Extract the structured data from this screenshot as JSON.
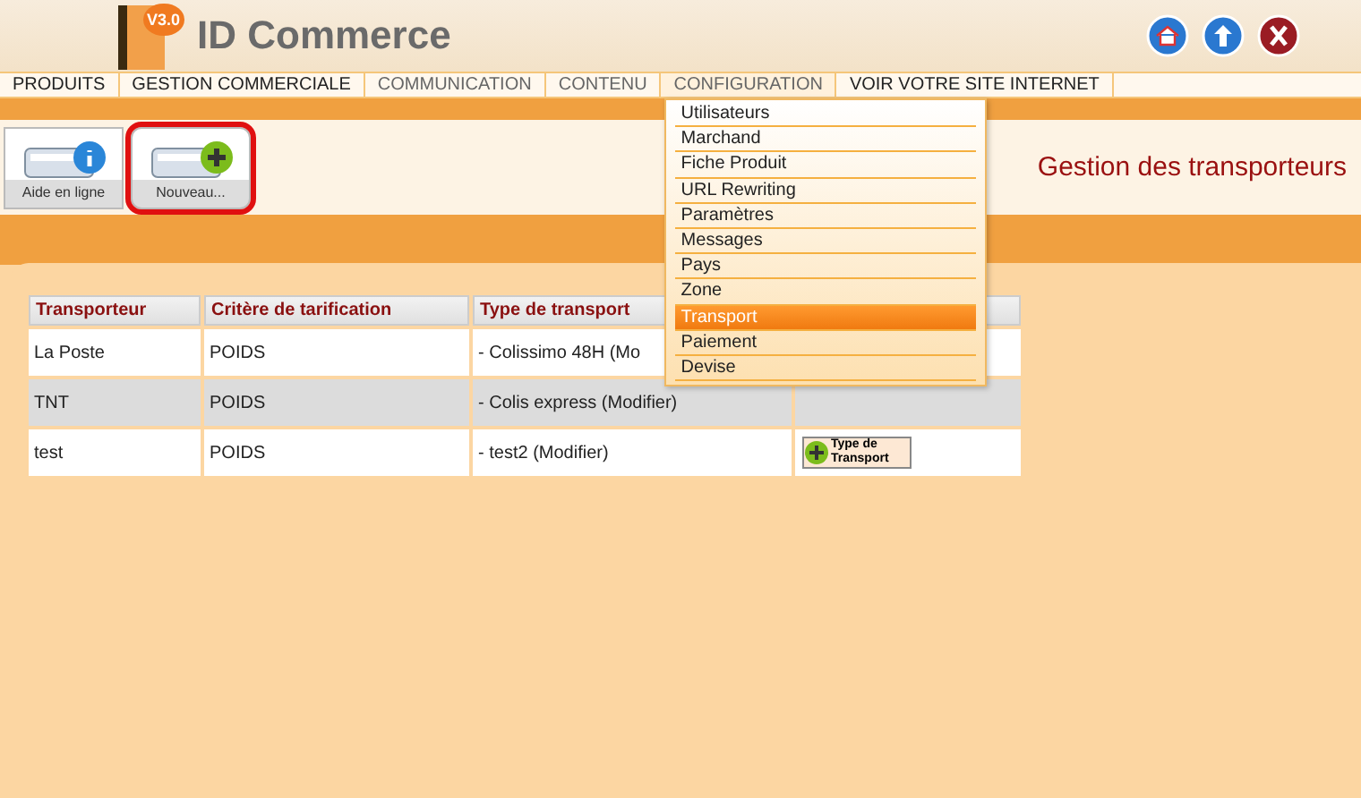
{
  "header": {
    "logo_badge": "V3.0",
    "brand": "ID Commerce"
  },
  "nav": [
    {
      "label": "PRODUITS",
      "selected": false,
      "dimmed": false
    },
    {
      "label": "GESTION COMMERCIALE",
      "selected": false,
      "dimmed": false
    },
    {
      "label": "COMMUNICATION",
      "selected": false,
      "dimmed": true
    },
    {
      "label": "CONTENU",
      "selected": false,
      "dimmed": true
    },
    {
      "label": "CONFIGURATION",
      "selected": true,
      "dimmed": true
    },
    {
      "label": "VOIR VOTRE SITE INTERNET",
      "selected": false,
      "dimmed": false
    }
  ],
  "dropdown": [
    {
      "label": "Utilisateurs",
      "selected": false
    },
    {
      "label": "Marchand",
      "selected": false
    },
    {
      "label": "Fiche Produit",
      "selected": false
    },
    {
      "label": "URL Rewriting",
      "selected": false
    },
    {
      "label": "Paramètres",
      "selected": false
    },
    {
      "label": "Messages",
      "selected": false
    },
    {
      "label": "Pays",
      "selected": false
    },
    {
      "label": "Zone",
      "selected": false
    },
    {
      "label": "Transport",
      "selected": true
    },
    {
      "label": "Paiement",
      "selected": false
    },
    {
      "label": "Devise",
      "selected": false
    }
  ],
  "toolbar": [
    {
      "label": "Aide en ligne",
      "kind": "info",
      "highlighted": false
    },
    {
      "label": "Nouveau...",
      "kind": "add",
      "highlighted": true
    }
  ],
  "page_title": "Gestion des transporteurs",
  "table": {
    "columns": [
      "Transporteur",
      "Critère de tarification",
      "Type de transport"
    ],
    "rows": [
      {
        "cells": [
          "La Poste",
          "POIDS",
          "- Colissimo 48H (Mo"
        ],
        "shaded": false
      },
      {
        "cells": [
          "TNT",
          "POIDS",
          "- Colis express (Modifier)"
        ],
        "shaded": true
      },
      {
        "cells": [
          "test",
          "POIDS",
          "- test2 (Modifier)"
        ],
        "shaded": false,
        "action": "Type de Transport"
      }
    ]
  }
}
